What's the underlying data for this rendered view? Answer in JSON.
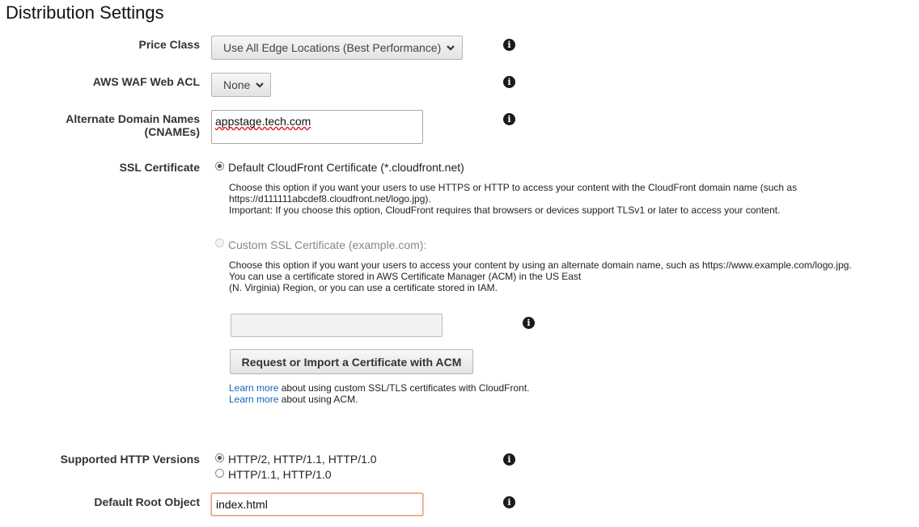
{
  "section_title": "Distribution Settings",
  "price_class": {
    "label": "Price Class",
    "value": "Use All Edge Locations (Best Performance)"
  },
  "waf": {
    "label": "AWS WAF Web ACL",
    "value": "None"
  },
  "cnames": {
    "label_line1": "Alternate Domain Names",
    "label_line2": "(CNAMEs)",
    "value": "appstage.tech.com"
  },
  "ssl": {
    "label": "SSL Certificate",
    "default_option": "Default CloudFront Certificate (*.cloudfront.net)",
    "default_desc_line1": "Choose this option if you want your users to use HTTPS or HTTP to access your content with the CloudFront domain name (such as",
    "default_desc_line2": "https://d111111abcdef8.cloudfront.net/logo.jpg).",
    "default_desc_line3": "Important: If you choose this option, CloudFront requires that browsers or devices support TLSv1 or later to access your content.",
    "custom_option": "Custom SSL Certificate (example.com):",
    "custom_desc_line1": "Choose this option if you want your users to access your content by using an alternate domain name, such as https://www.example.com/logo.jpg.",
    "custom_desc_line2": "You can use a certificate stored in AWS Certificate Manager (ACM) in the US East",
    "custom_desc_line3": "(N. Virginia) Region, or you can use a certificate stored in IAM.",
    "acm_button": "Request or Import a Certificate with ACM",
    "learn_more_1_link": "Learn more",
    "learn_more_1_text": " about using custom SSL/TLS certificates with CloudFront.",
    "learn_more_2_link": "Learn more",
    "learn_more_2_text": " about using ACM."
  },
  "http_versions": {
    "label": "Supported HTTP Versions",
    "option1": "HTTP/2, HTTP/1.1, HTTP/1.0",
    "option2": "HTTP/1.1, HTTP/1.0"
  },
  "root_object": {
    "label": "Default Root Object",
    "value": "index.html"
  },
  "icons": {
    "info": "info-icon",
    "chevron": "chevron-down-icon"
  }
}
